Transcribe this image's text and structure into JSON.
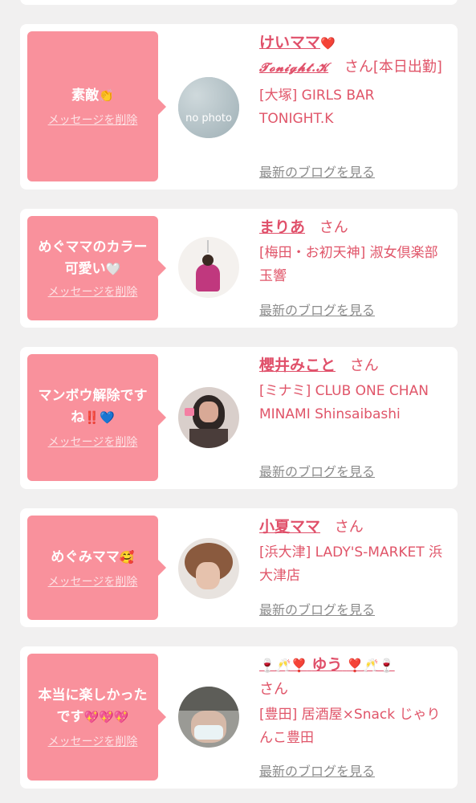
{
  "delete_label": "メッセージを削除",
  "blog_label": "最新のブログを見る",
  "san": "さん",
  "cards": [
    {
      "message": "素敵",
      "message_emoji": "👏",
      "name": "けいママ",
      "name_emoji": "❤️",
      "store_brand": "𝓣𝓸𝓷𝓲𝓰𝓱𝓽.𝓚",
      "honjitsu": "[本日出勤]",
      "shop": "[大塚] GIRLS BAR TONIGHT.K",
      "avatar": "no-photo",
      "avatar_text": "no photo"
    },
    {
      "message": "めぐママのカラー可愛い",
      "message_emoji": "🤍",
      "name": "まりあ",
      "shop": "[梅田・お初天神] 淑女倶楽部 玉響",
      "avatar": "woman-in-pink-dress"
    },
    {
      "message": "マンボウ解除ですね",
      "message_emoji": "‼️💙",
      "name": "櫻井みこと",
      "shop": "[ミナミ] CLUB ONE CHAN MINAMI Shinsaibashi",
      "avatar": "woman-selfie"
    },
    {
      "message": "めぐみママ",
      "message_emoji": "🥰",
      "name": "小夏ママ",
      "shop": "[浜大津] LADY'S-MARKET 浜大津店",
      "avatar": "woman-updo-hair"
    },
    {
      "message": "本当に楽しかったです",
      "message_emoji": "💖💖💖",
      "name_prefix": "🍷🥂❣️",
      "name": "ゆう",
      "name_suffix": "❣️🥂🍷",
      "shop": "[豊田] 居酒屋×Snack じゃりんこ豊田",
      "avatar": "woman-with-mask"
    }
  ]
}
